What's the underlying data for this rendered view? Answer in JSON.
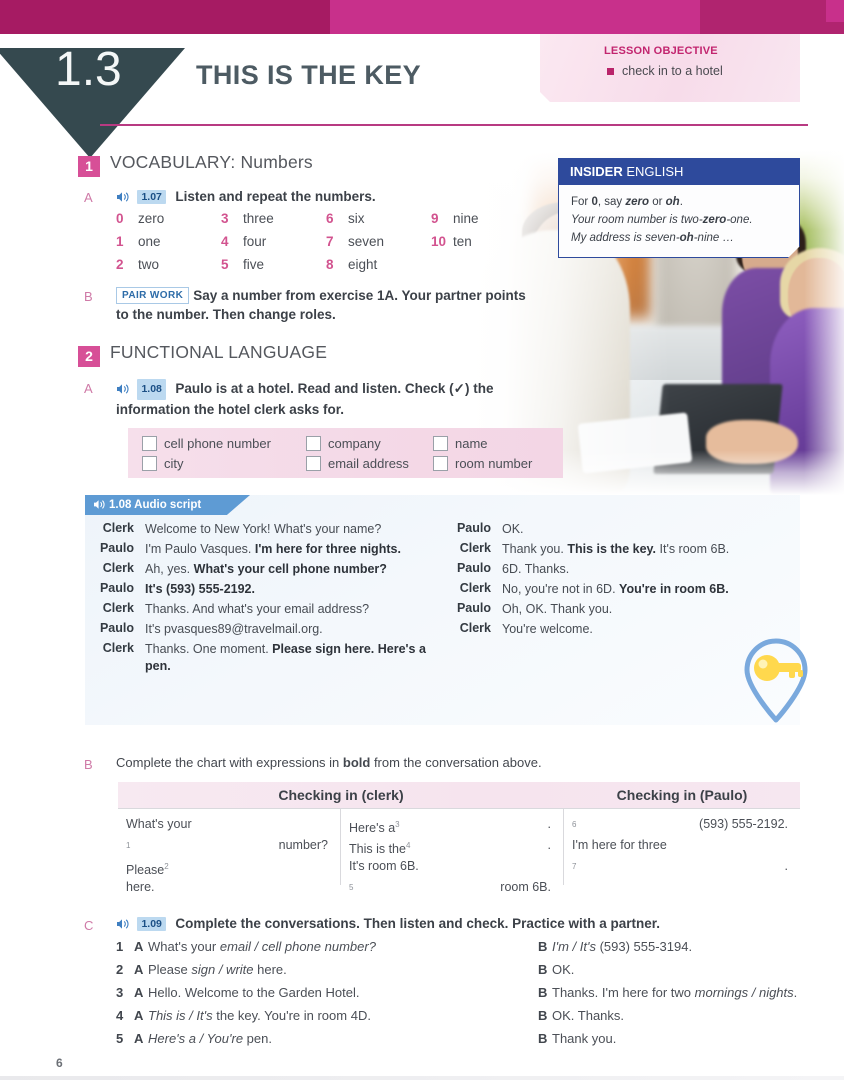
{
  "header": {
    "lesson_number": "1.3",
    "title": "THIS IS THE KEY",
    "objective_label": "LESSON OBJECTIVE",
    "objective_item": "check in to a hotel",
    "colors": {
      "magenta": "#c8308b",
      "dark_teal": "#35494f",
      "rule": "#b83a82"
    }
  },
  "vocabulary": {
    "badge": "1",
    "title": "VOCABULARY: Numbers",
    "a": {
      "letter": "A",
      "audio_icon": "speaker-icon",
      "track": "1.07",
      "instruction": "Listen and repeat the numbers.",
      "numbers": [
        {
          "n": "0",
          "w": "zero"
        },
        {
          "n": "3",
          "w": "three"
        },
        {
          "n": "6",
          "w": "six"
        },
        {
          "n": "9",
          "w": "nine"
        },
        {
          "n": "1",
          "w": "one"
        },
        {
          "n": "4",
          "w": "four"
        },
        {
          "n": "7",
          "w": "seven"
        },
        {
          "n": "10",
          "w": "ten"
        },
        {
          "n": "2",
          "w": "two"
        },
        {
          "n": "5",
          "w": "five"
        },
        {
          "n": "8",
          "w": "eight"
        },
        {
          "n": "",
          "w": ""
        }
      ]
    },
    "b": {
      "letter": "B",
      "tag": "PAIR WORK",
      "instruction": "Say a number from exercise 1A. Your partner points to the number. Then change roles."
    }
  },
  "insider": {
    "title_bold": "INSIDER",
    "title_rest": " ENGLISH",
    "line1_pre": "For ",
    "line1_b1": "0",
    "line1_mid": ", say ",
    "line1_b2": "zero",
    "line1_mid2": " or ",
    "line1_b3": "oh",
    "line1_end": ".",
    "line2_pre": "Your room number is two-",
    "line2_b": "zero",
    "line2_end": "-one.",
    "line3_pre": "My address is seven-",
    "line3_b": "oh",
    "line3_end": "-nine …"
  },
  "functional": {
    "badge": "2",
    "title": "FUNCTIONAL LANGUAGE",
    "a": {
      "letter": "A",
      "audio_icon": "speaker-icon",
      "track": "1.08",
      "instruction": "Paulo is at a hotel. Read and listen. Check (✓) the information the hotel clerk asks for.",
      "checkboxes": [
        "cell phone number",
        "city",
        "company",
        "email address",
        "name",
        "room number"
      ]
    },
    "script": {
      "banner_icon": "speaker-icon",
      "banner": "1.08 Audio script",
      "left": [
        {
          "speaker": "Clerk",
          "parts": [
            {
              "t": "Welcome to New York! What's your name?",
              "b": false
            }
          ]
        },
        {
          "speaker": "Paulo",
          "parts": [
            {
              "t": "I'm Paulo Vasques. ",
              "b": false
            },
            {
              "t": "I'm here for three nights.",
              "b": true
            }
          ]
        },
        {
          "speaker": "Clerk",
          "parts": [
            {
              "t": "Ah, yes. ",
              "b": false
            },
            {
              "t": "What's your cell phone number?",
              "b": true
            }
          ]
        },
        {
          "speaker": "Paulo",
          "parts": [
            {
              "t": "It's (593) 555-2192.",
              "b": true
            }
          ]
        },
        {
          "speaker": "Clerk",
          "parts": [
            {
              "t": "Thanks. And what's your email address?",
              "b": false
            }
          ]
        },
        {
          "speaker": "Paulo",
          "parts": [
            {
              "t": "It's pvasques89@travelmail.org.",
              "b": false
            }
          ]
        },
        {
          "speaker": "Clerk",
          "parts": [
            {
              "t": "Thanks. One moment. ",
              "b": false
            },
            {
              "t": "Please sign here. Here's a pen.",
              "b": true
            }
          ]
        }
      ],
      "right": [
        {
          "speaker": "Paulo",
          "parts": [
            {
              "t": "OK.",
              "b": false
            }
          ]
        },
        {
          "speaker": "Clerk",
          "parts": [
            {
              "t": "Thank you. ",
              "b": false
            },
            {
              "t": "This is the key.",
              "b": true
            },
            {
              "t": " It's room 6B.",
              "b": false
            }
          ]
        },
        {
          "speaker": "Paulo",
          "parts": [
            {
              "t": "6D. Thanks.",
              "b": false
            }
          ]
        },
        {
          "speaker": "Clerk",
          "parts": [
            {
              "t": "No, you're not in 6D. ",
              "b": false
            },
            {
              "t": "You're in room 6B.",
              "b": true
            }
          ]
        },
        {
          "speaker": "Paulo",
          "parts": [
            {
              "t": "Oh, OK. Thank you.",
              "b": false
            }
          ]
        },
        {
          "speaker": "Clerk",
          "parts": [
            {
              "t": "You're welcome.",
              "b": false
            }
          ]
        }
      ]
    },
    "b": {
      "letter": "B",
      "instruction_pre": "Complete the chart with expressions in ",
      "instruction_bold": "bold",
      "instruction_post": " from the conversation above.",
      "chart": {
        "header_clerk": "Checking in (clerk)",
        "header_paulo": "Checking in (Paulo)",
        "col1": [
          {
            "text": "What's your",
            "sup": "",
            "right": ""
          },
          {
            "text": "",
            "sup": "1",
            "right": "number?"
          },
          {
            "text": "Please",
            "sup": "2",
            "right": ""
          },
          {
            "text": "here.",
            "sup": "",
            "right": ""
          }
        ],
        "col2": [
          {
            "text": "Here's a",
            "sup": "3",
            "right": "."
          },
          {
            "text": "This is the",
            "sup": "4",
            "right": "."
          },
          {
            "text": "It's room 6B.",
            "sup": "",
            "right": ""
          },
          {
            "text": "",
            "sup": "5",
            "right": "room 6B."
          }
        ],
        "col3": [
          {
            "text": "",
            "sup": "6",
            "right": "(593) 555-2192."
          },
          {
            "text": "I'm here for three",
            "sup": "",
            "right": ""
          },
          {
            "text": "",
            "sup": "7",
            "right": "."
          }
        ]
      }
    }
  },
  "section_c": {
    "letter": "C",
    "audio_icon": "speaker-icon",
    "track": "1.09",
    "instruction": "Complete the conversations. Then listen and check. Practice with a partner.",
    "speaker_a": "A",
    "speaker_b": "B",
    "rows": [
      {
        "num": "1",
        "a": [
          {
            "t": "What's your ",
            "i": false
          },
          {
            "t": "email / cell phone number?",
            "i": true
          }
        ],
        "b": [
          {
            "t": "I'm / It's",
            "i": true
          },
          {
            "t": " (593) 555-3194.",
            "i": false
          }
        ]
      },
      {
        "num": "2",
        "a": [
          {
            "t": "Please ",
            "i": false
          },
          {
            "t": "sign / write",
            "i": true
          },
          {
            "t": " here.",
            "i": false
          }
        ],
        "b": [
          {
            "t": "OK.",
            "i": false
          }
        ]
      },
      {
        "num": "3",
        "a": [
          {
            "t": "Hello. Welcome to the Garden Hotel.",
            "i": false
          }
        ],
        "b": [
          {
            "t": "Thanks. I'm here for two ",
            "i": false
          },
          {
            "t": "mornings / nights",
            "i": true
          },
          {
            "t": ".",
            "i": false
          }
        ]
      },
      {
        "num": "4",
        "a": [
          {
            "t": "This is / It's",
            "i": true
          },
          {
            "t": " the key. You're in room 4D.",
            "i": false
          }
        ],
        "b": [
          {
            "t": "OK. Thanks.",
            "i": false
          }
        ]
      },
      {
        "num": "5",
        "a": [
          {
            "t": "Here's a / You're",
            "i": true
          },
          {
            "t": " pen.",
            "i": false
          }
        ],
        "b": [
          {
            "t": "Thank you.",
            "i": false
          }
        ]
      }
    ]
  },
  "page_number": "6",
  "decor": {
    "key_pin_icon": "key-location-pin-icon",
    "photo": "hotel-check-in-photo"
  }
}
